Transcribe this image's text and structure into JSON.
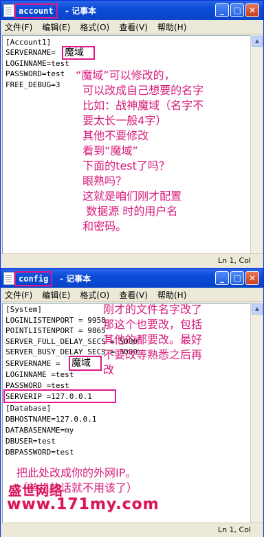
{
  "window1": {
    "file_name": "account",
    "title_suffix": "- 记事本",
    "buttons": {
      "minimize": "_",
      "maximize": "□",
      "close": "✕"
    },
    "menu": [
      "文件(F)",
      "编辑(E)",
      "格式(O)",
      "查看(V)",
      "帮助(H)"
    ],
    "lines": [
      "[Account1]",
      "SERVERNAME=",
      "LOGINNAME=test",
      "PASSWORD=test",
      "FREE_DEBUG=3"
    ],
    "servername_value": "魔域",
    "note": "“魔域”可以修改的，\n  可以改成自己想要的名字\n  比如：战神魔域（名字不\n  要太长一般4字）\n  其他不要修改\n  看到“魔域”\n  下面的test了吗？\n  眼熟吗？\n  这就是咱们刚才配置\n   数据源 时的用户名\n  和密码。",
    "status": "Ln 1, Col"
  },
  "window2": {
    "file_name": "config",
    "title_suffix": "- 记事本",
    "buttons": {
      "minimize": "_",
      "maximize": "□",
      "close": "✕"
    },
    "menu": [
      "文件(F)",
      "编辑(E)",
      "格式(O)",
      "查看(V)",
      "帮助(H)"
    ],
    "lines": [
      "[System]",
      "LOGINLISTENPORT = 9958",
      "POINTLISTENPORT = 9865",
      "SERVER_FULL_DELAY_SECS = 5000",
      "SERVER_BUSY_DELAY_SECS = 3000",
      "SERVERNAME =",
      "LOGINNAME =test",
      "PASSWORD =test",
      "SERVERIP =127.0.0.1",
      "[Database]",
      "DBHOSTNAME=127.0.0.1",
      "DATABASENAME=my",
      "DBUSER=test",
      "DBPASSWORD=test"
    ],
    "servername_value": "魔域",
    "note_top": "刚才的文件名字改了\n那这个也要改，包括\n其他的都要改。最好\n不要改等熟悉之后再\n改",
    "note_bottom": "把此处改成你的外网IP。\n（单机的话就不用该了）",
    "status": "Ln 1, Col"
  },
  "watermark": {
    "line1": "盛世网络",
    "line2": "www.171my.com"
  }
}
